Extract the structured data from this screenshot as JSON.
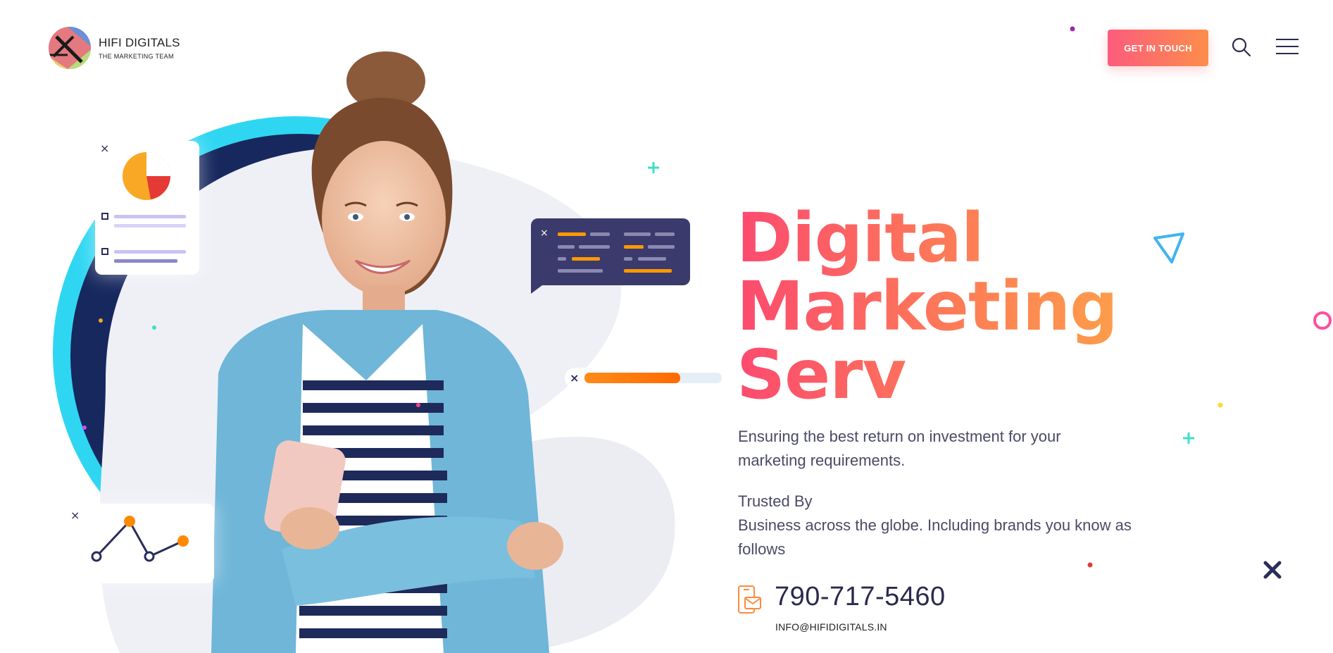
{
  "brand": {
    "name": "HIFI DIGITALS",
    "tagline": "THE MARKETING TEAM"
  },
  "header": {
    "cta_label": "GET IN TOUCH",
    "search_icon": "search-icon",
    "menu_icon": "hamburger-menu-icon"
  },
  "hero": {
    "title_line1": "Digital",
    "title_line2": "Marketing",
    "title_line3": "Serv",
    "description": "Ensuring the best return on investment for your marketing requirements.",
    "trusted_label": "Trusted By",
    "trusted_text": "Business across the globe. Including brands you know as follows",
    "phone": "790-717-5460",
    "email": "INFO@HIFIDIGITALS.IN"
  },
  "colors": {
    "accent_start": "#fc5c7d",
    "accent_end": "#fd8d4a",
    "navy": "#2b2d5c",
    "cyan": "#2fd3f0",
    "teal": "#3de0c4"
  }
}
